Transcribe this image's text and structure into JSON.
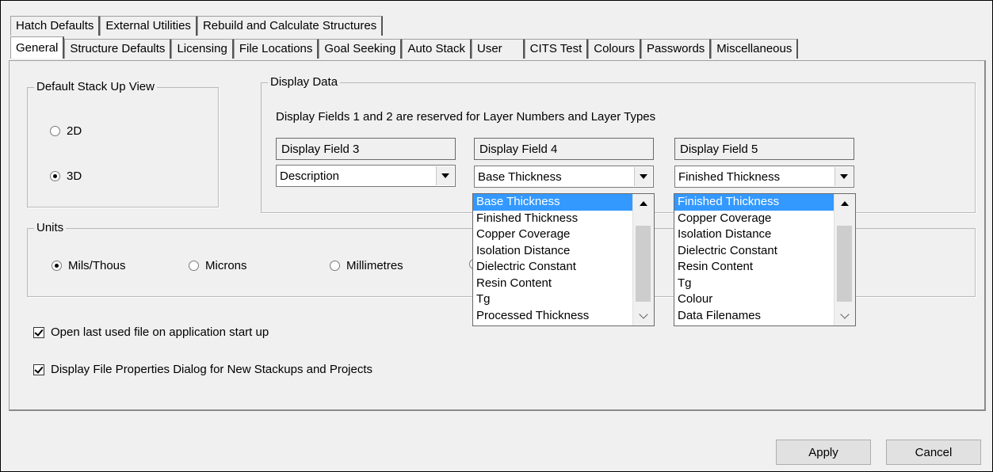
{
  "tabs_back": [
    {
      "label": "Hatch Defaults"
    },
    {
      "label": "External Utilities"
    },
    {
      "label": "Rebuild and Calculate Structures"
    }
  ],
  "tabs_front": [
    {
      "label": "General",
      "selected": true
    },
    {
      "label": "Structure Defaults"
    },
    {
      "label": "Licensing"
    },
    {
      "label": "File Locations"
    },
    {
      "label": "Goal Seeking"
    },
    {
      "label": "Auto Stack"
    },
    {
      "label": "User"
    },
    {
      "label": "CITS Test"
    },
    {
      "label": "Colours"
    },
    {
      "label": "Passwords"
    },
    {
      "label": "Miscellaneous"
    }
  ],
  "stack_view": {
    "caption": "Default Stack Up View",
    "options": [
      {
        "label": "2D",
        "selected": false
      },
      {
        "label": "3D",
        "selected": true
      }
    ]
  },
  "display_data": {
    "caption": "Display Data",
    "note": "Display Fields 1 and 2 are reserved for Layer Numbers and Layer Types",
    "fields": [
      {
        "header": "Display Field 3",
        "value": "Description"
      },
      {
        "header": "Display Field 4",
        "value": "Base Thickness"
      },
      {
        "header": "Display Field 5",
        "value": "Finished Thickness"
      }
    ]
  },
  "dropdown_field4": {
    "items": [
      "Base Thickness",
      "Finished Thickness",
      "Copper Coverage",
      "Isolation Distance",
      "Dielectric Constant",
      "Resin Content",
      "Tg",
      "Processed Thickness"
    ],
    "selected": "Base Thickness"
  },
  "dropdown_field5": {
    "items": [
      "Finished Thickness",
      "Copper Coverage",
      "Isolation Distance",
      "Dielectric Constant",
      "Resin Content",
      "Tg",
      "Colour",
      "Data Filenames"
    ],
    "selected": "Finished Thickness"
  },
  "units": {
    "caption": "Units",
    "options": [
      {
        "label": "Mils/Thous",
        "selected": true
      },
      {
        "label": "Microns",
        "selected": false
      },
      {
        "label": "Millimetres",
        "selected": false
      }
    ]
  },
  "checkboxes": [
    {
      "label": "Open last used file on application start up",
      "checked": true
    },
    {
      "label": "Display File Properties Dialog for New Stackups and Projects",
      "checked": true
    }
  ],
  "buttons": {
    "apply": "Apply",
    "cancel": "Cancel"
  },
  "colors": {
    "selection": "#3399ff",
    "window_bg": "#f0f0f0"
  }
}
